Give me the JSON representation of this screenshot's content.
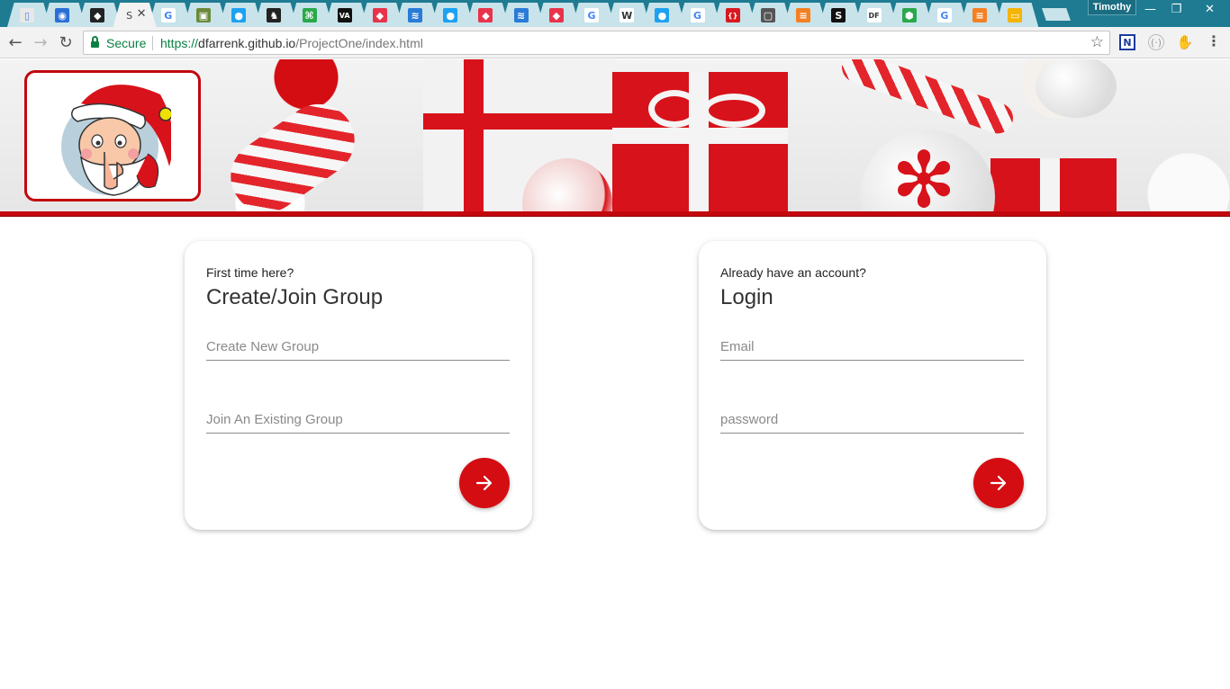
{
  "browser": {
    "tabs": [
      {
        "icon": "doc-icon",
        "color": "#e8e8e8",
        "glyph": "▯"
      },
      {
        "icon": "eye-icon",
        "color": "#2a6fd6",
        "glyph": "◉"
      },
      {
        "icon": "github-icon",
        "color": "#222222",
        "glyph": "◆"
      },
      {
        "icon": "page-icon",
        "color": "#f2f2f2",
        "glyph": "S",
        "active": true
      },
      {
        "icon": "google-icon",
        "color": "#ffffff",
        "glyph": "G"
      },
      {
        "icon": "photo-icon",
        "color": "#6a8a3a",
        "glyph": "▣"
      },
      {
        "icon": "bird-icon",
        "color": "#1da1f2",
        "glyph": "●"
      },
      {
        "icon": "unicorn-icon",
        "color": "#222222",
        "glyph": "♞"
      },
      {
        "icon": "bracket-icon",
        "color": "#2aa84a",
        "glyph": "⌘"
      },
      {
        "icon": "va-icon",
        "color": "#111111",
        "glyph": "VA"
      },
      {
        "icon": "fox-icon",
        "color": "#e8334a",
        "glyph": "◆"
      },
      {
        "icon": "wave-icon",
        "color": "#2a7bd6",
        "glyph": "≋"
      },
      {
        "icon": "bird-icon",
        "color": "#1da1f2",
        "glyph": "●"
      },
      {
        "icon": "fox-icon",
        "color": "#e8334a",
        "glyph": "◆"
      },
      {
        "icon": "wave-icon",
        "color": "#2a7bd6",
        "glyph": "≋"
      },
      {
        "icon": "fox-icon",
        "color": "#e8334a",
        "glyph": "◆"
      },
      {
        "icon": "google-icon",
        "color": "#ffffff",
        "glyph": "G"
      },
      {
        "icon": "wikipedia-icon",
        "color": "#ffffff",
        "glyph": "W"
      },
      {
        "icon": "bird-icon",
        "color": "#1da1f2",
        "glyph": "●"
      },
      {
        "icon": "google-icon",
        "color": "#ffffff",
        "glyph": "G"
      },
      {
        "icon": "braces-icon",
        "color": "#d7191f",
        "glyph": "{}"
      },
      {
        "icon": "terminal-icon",
        "color": "#555555",
        "glyph": "▢"
      },
      {
        "icon": "stack-icon",
        "color": "#f48024",
        "glyph": "≡"
      },
      {
        "icon": "s-icon",
        "color": "#111111",
        "glyph": "S"
      },
      {
        "icon": "df-icon",
        "color": "#ffffff",
        "glyph": "DF"
      },
      {
        "icon": "cube-icon",
        "color": "#2aa84a",
        "glyph": "⬢"
      },
      {
        "icon": "google-icon",
        "color": "#ffffff",
        "glyph": "G"
      },
      {
        "icon": "stack-icon",
        "color": "#f48024",
        "glyph": "≡"
      },
      {
        "icon": "slides-icon",
        "color": "#f4b400",
        "glyph": "▭"
      }
    ],
    "profile_name": "Timothy",
    "window_controls": {
      "minimize": "—",
      "restore": "❐",
      "close": "✕"
    },
    "nav": {
      "back": "←",
      "forward": "→",
      "reload": "↻"
    },
    "address": {
      "secure_label": "Secure",
      "protocol": "https://",
      "host": "dfarrenk.github.io",
      "path": "/ProjectOne/index.html",
      "star": "☆"
    },
    "extensions": {
      "n": "N",
      "c": "(·)",
      "f": "✋"
    },
    "menu": "⋮"
  },
  "create_card": {
    "kicker": "First time here?",
    "title": "Create/Join Group",
    "field1_placeholder": "Create New Group",
    "field2_placeholder": "Join An Existing Group"
  },
  "login_card": {
    "kicker": "Already have an account?",
    "title": "Login",
    "field1_placeholder": "Email",
    "field2_placeholder": "password"
  },
  "colors": {
    "accent": "#d40d12",
    "tabstrip": "#1e7b91"
  }
}
